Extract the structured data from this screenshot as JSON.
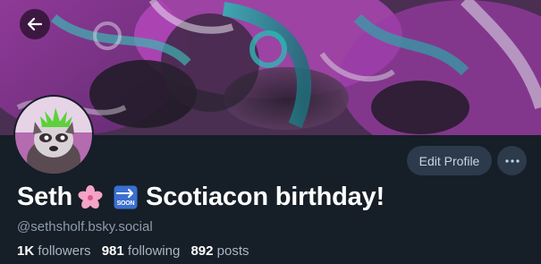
{
  "profile": {
    "display_name": "Seth",
    "display_name_tail": "Scotiacon birthday!",
    "handle": "@sethsholf.bsky.social",
    "soon_label": "SOON",
    "stats": {
      "followers_count": "1K",
      "followers_label": "followers",
      "following_count": "981",
      "following_label": "following",
      "posts_count": "892",
      "posts_label": "posts"
    }
  },
  "actions": {
    "edit_profile_label": "Edit Profile"
  },
  "icons": {
    "back": "back-arrow-icon",
    "more": "more-horizontal-icon",
    "blossom": "cherry-blossom-icon",
    "soon": "soon-arrow-icon"
  },
  "colors": {
    "background": "#161e27",
    "button_bg": "#2c3a4b",
    "text_primary": "#ffffff",
    "text_secondary": "#8d9bab",
    "banner_magenta": "#c640c8",
    "banner_teal": "#3aa7a8",
    "soon_blue": "#3b6fd1"
  }
}
